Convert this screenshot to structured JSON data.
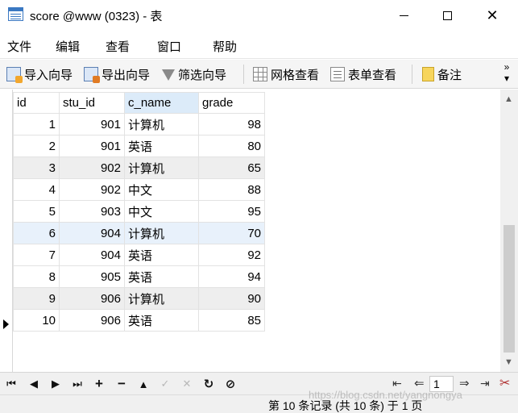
{
  "window": {
    "title": "score @www (0323) - 表",
    "minimize_icon": "minimize-icon",
    "maximize_icon": "maximize-icon",
    "close_glyph": "✕"
  },
  "menu": [
    "文件",
    "编辑",
    "查看",
    "窗口",
    "帮助"
  ],
  "toolbar": {
    "import_label": "导入向导",
    "export_label": "导出向导",
    "filter_label": "筛选向导",
    "grid_view_label": "网格查看",
    "form_view_label": "表单查看",
    "memo_label": "备注",
    "more_glyph": "»"
  },
  "table": {
    "columns": [
      "id",
      "stu_id",
      "c_name",
      "grade"
    ],
    "active_column": "c_name",
    "rows": [
      {
        "id": "1",
        "stu_id": "901",
        "c_name": "计算机",
        "grade": "98"
      },
      {
        "id": "2",
        "stu_id": "901",
        "c_name": "英语",
        "grade": "80"
      },
      {
        "id": "3",
        "stu_id": "902",
        "c_name": "计算机",
        "grade": "65"
      },
      {
        "id": "4",
        "stu_id": "902",
        "c_name": "中文",
        "grade": "88"
      },
      {
        "id": "5",
        "stu_id": "903",
        "c_name": "中文",
        "grade": "95"
      },
      {
        "id": "6",
        "stu_id": "904",
        "c_name": "计算机",
        "grade": "70"
      },
      {
        "id": "7",
        "stu_id": "904",
        "c_name": "英语",
        "grade": "92"
      },
      {
        "id": "8",
        "stu_id": "905",
        "c_name": "英语",
        "grade": "94"
      },
      {
        "id": "9",
        "stu_id": "906",
        "c_name": "计算机",
        "grade": "90"
      },
      {
        "id": "10",
        "stu_id": "906",
        "c_name": "英语",
        "grade": "85"
      }
    ],
    "current_row_index": 9
  },
  "navigator": {
    "first": "⏮",
    "prev": "◀",
    "next": "▶",
    "last": "⏭",
    "add": "+",
    "delete": "−",
    "up": "▲",
    "apply": "✓",
    "cancel": "✕",
    "refresh": "↻",
    "stop": "⊘",
    "page_first": "⇤",
    "page_prev": "⇐",
    "page_value": "1",
    "page_next": "⇒",
    "page_last": "⇥",
    "tools_glyph": "✂"
  },
  "status": {
    "text": "第 10 条记录 (共 10 条) 于 1 页",
    "watermark": "https://blog.csdn.net/yangnongya"
  },
  "colors": {
    "active_header": "#dcebf9",
    "alt_row": "#eeeeee",
    "highlight_row": "#e8f1fb"
  }
}
